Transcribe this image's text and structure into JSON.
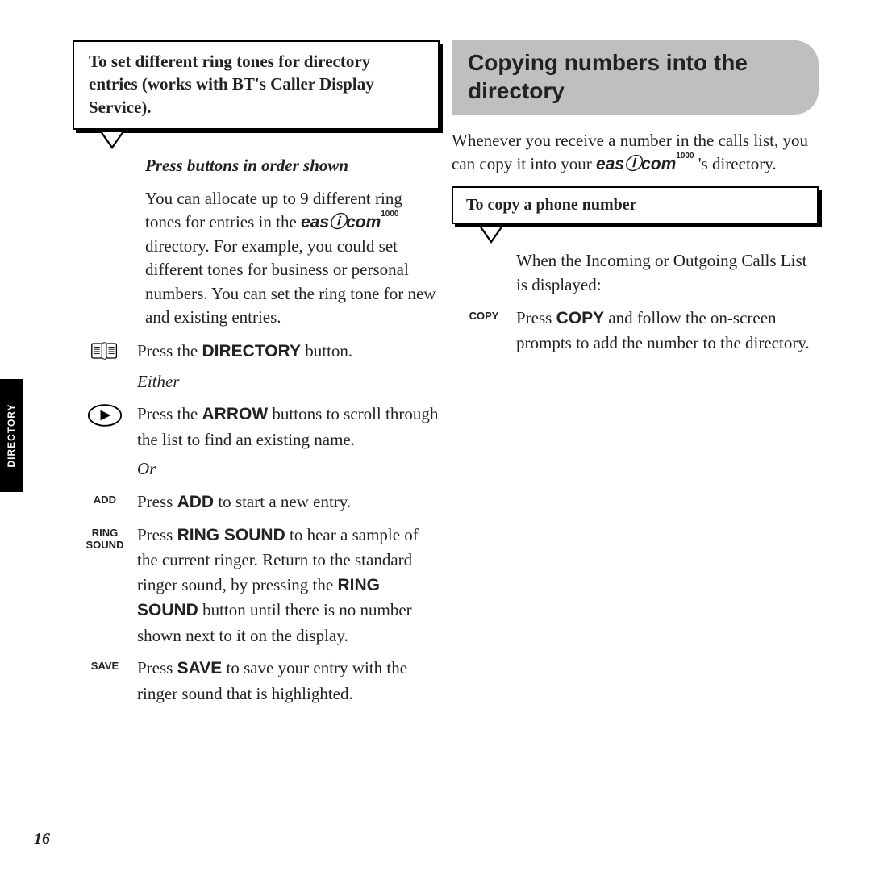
{
  "tab": "DIRECTORY",
  "pageNumber": "16",
  "left": {
    "titleBox": "To set different ring tones for directory entries (works with BT's Caller Display Service).",
    "pressOrder": "Press buttons in order shown",
    "intro1": "You can allocate up to 9 different ring tones for entries in the ",
    "brand": "easⓘcom",
    "brandSup": "1000",
    "intro2": " directory. For example, you could set different tones for business or personal numbers. You can set the ring tone for new and existing entries.",
    "step1a": "Press the ",
    "step1b": "DIRECTORY",
    "step1c": " button.",
    "either": "Either",
    "step2a": "Press the ",
    "step2b": "ARROW",
    "step2c": " buttons to scroll through the list to find an existing name.",
    "or": "Or",
    "addLabel": "ADD",
    "step3a": "Press ",
    "step3b": "ADD",
    "step3c": " to start a new entry.",
    "ringLabel1": "RING",
    "ringLabel2": "SOUND",
    "step4a": "Press ",
    "step4b": "RING SOUND",
    "step4c": " to hear a sample of the current ringer. Return to the standard ringer sound, by pressing the ",
    "step4d": "RING SOUND",
    "step4e": " button until there is no number shown next to it on the display.",
    "saveLabel": "SAVE",
    "step5a": "Press ",
    "step5b": "SAVE",
    "step5c": " to save your entry with the ringer sound that is highlighted."
  },
  "right": {
    "heading": "Copying numbers into the directory",
    "lead1": "Whenever you receive a number in the calls list, you can copy it into your ",
    "brand": "easⓘcom",
    "brandSup": "1000",
    "lead2": " 's directory.",
    "box": "To copy a phone number",
    "when": "When the Incoming or Outgoing Calls List is displayed:",
    "copyLabel": "COPY",
    "copy1a": "Press ",
    "copy1b": "COPY",
    "copy1c": " and follow the on-screen prompts to add the number to the directory."
  }
}
